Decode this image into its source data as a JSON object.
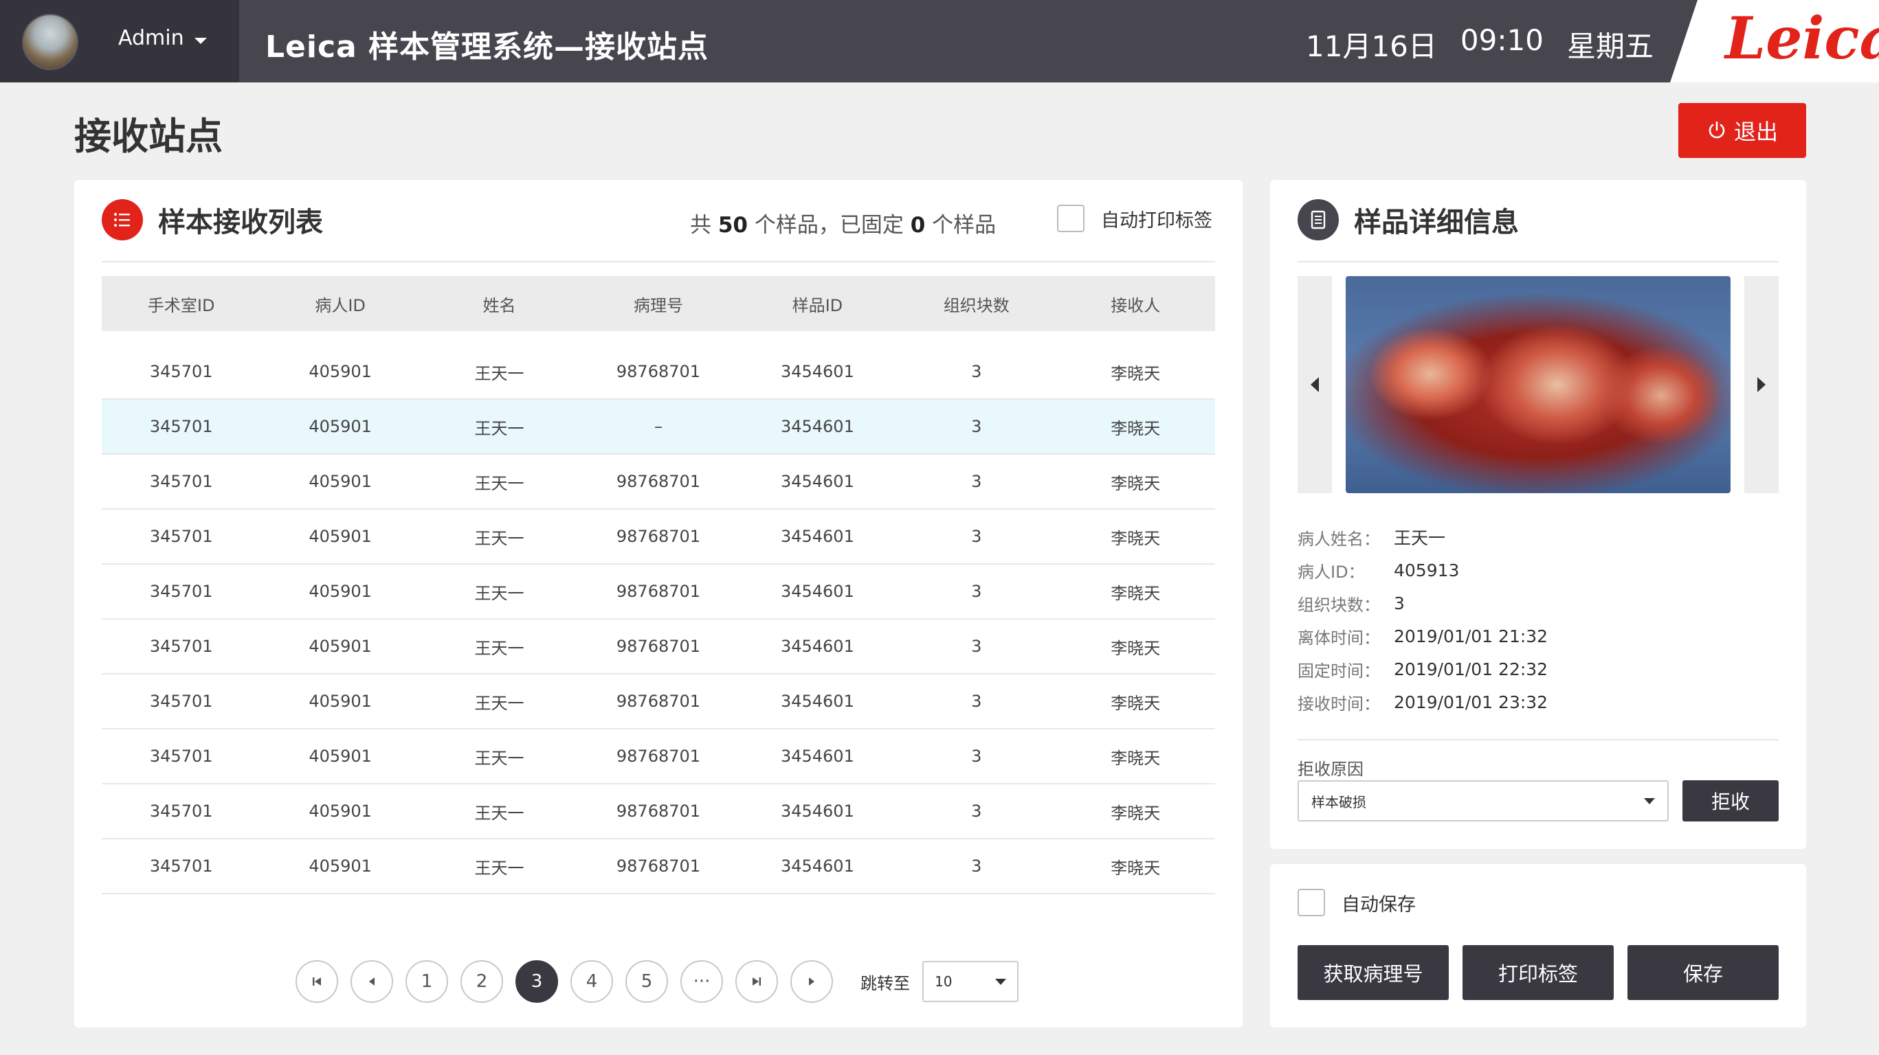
{
  "topbar": {
    "user": "Admin",
    "app_title": "Leica 样本管理系统—接收站点",
    "date": "11月16日",
    "time": "09:10",
    "weekday": "星期五",
    "logo": "Leica"
  },
  "page": {
    "title": "接收站点",
    "exit_label": "退出"
  },
  "list_panel": {
    "title": "样本接收列表",
    "summary_prefix": "共",
    "total": "50",
    "summary_mid": "个样品，已固定",
    "fixed": "0",
    "summary_suffix": "个样品",
    "auto_print_label": "自动打印标签",
    "columns": [
      "手术室ID",
      "病人ID",
      "姓名",
      "病理号",
      "样品ID",
      "组织块数",
      "接收人"
    ],
    "rows": [
      [
        "345701",
        "405901",
        "王天一",
        "98768701",
        "3454601",
        "3",
        "李晓天"
      ],
      [
        "345701",
        "405901",
        "王天一",
        "–",
        "3454601",
        "3",
        "李晓天"
      ],
      [
        "345701",
        "405901",
        "王天一",
        "98768701",
        "3454601",
        "3",
        "李晓天"
      ],
      [
        "345701",
        "405901",
        "王天一",
        "98768701",
        "3454601",
        "3",
        "李晓天"
      ],
      [
        "345701",
        "405901",
        "王天一",
        "98768701",
        "3454601",
        "3",
        "李晓天"
      ],
      [
        "345701",
        "405901",
        "王天一",
        "98768701",
        "3454601",
        "3",
        "李晓天"
      ],
      [
        "345701",
        "405901",
        "王天一",
        "98768701",
        "3454601",
        "3",
        "李晓天"
      ],
      [
        "345701",
        "405901",
        "王天一",
        "98768701",
        "3454601",
        "3",
        "李晓天"
      ],
      [
        "345701",
        "405901",
        "王天一",
        "98768701",
        "3454601",
        "3",
        "李晓天"
      ],
      [
        "345701",
        "405901",
        "王天一",
        "98768701",
        "3454601",
        "3",
        "李晓天"
      ]
    ],
    "selected_row": 1
  },
  "pagination": {
    "pages": [
      "1",
      "2",
      "3",
      "4",
      "5",
      "···"
    ],
    "current": "3",
    "jump_label": "跳转至",
    "jump_value": "10"
  },
  "detail_panel": {
    "title": "样品详细信息",
    "fields": [
      {
        "label": "病人姓名：",
        "value": "王天一"
      },
      {
        "label": "病人ID：",
        "value": "405913"
      },
      {
        "label": "组织块数：",
        "value": "3"
      },
      {
        "label": "离体时间：",
        "value": "2019/01/01 21:32"
      },
      {
        "label": "固定时间：",
        "value": "2019/01/01 22:32"
      },
      {
        "label": "接收时间：",
        "value": "2019/01/01 23:32"
      }
    ],
    "reject_reason_label": "拒收原因",
    "reject_reason_value": "样本破损",
    "reject_button": "拒收"
  },
  "save_panel": {
    "auto_save_label": "自动保存",
    "buttons": [
      "获取病理号",
      "打印标签",
      "保存"
    ]
  },
  "colors": {
    "accent_red": "#e2231a",
    "topbar": "#47464f",
    "dark_button": "#3a3942",
    "selected_row": "#e8f8fc"
  }
}
